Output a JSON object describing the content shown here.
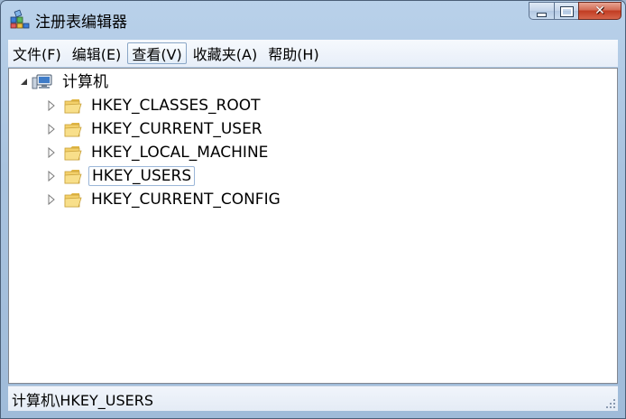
{
  "window": {
    "title": "注册表编辑器",
    "icon": "regedit-icon"
  },
  "caption_buttons": {
    "minimize_icon": "minimize-icon",
    "maximize_icon": "maximize-icon",
    "close_icon": "close-icon",
    "close_glyph": "✕"
  },
  "menubar": {
    "items": [
      {
        "label": "文件(F)"
      },
      {
        "label": "编辑(E)"
      },
      {
        "label": "查看(V)"
      },
      {
        "label": "收藏夹(A)"
      },
      {
        "label": "帮助(H)"
      }
    ],
    "active_index": 2
  },
  "tree": {
    "root": {
      "label": "计算机",
      "icon": "computer-icon",
      "expanded": true
    },
    "children": [
      {
        "label": "HKEY_CLASSES_ROOT",
        "icon": "folder-icon",
        "selected": false
      },
      {
        "label": "HKEY_CURRENT_USER",
        "icon": "folder-icon",
        "selected": false
      },
      {
        "label": "HKEY_LOCAL_MACHINE",
        "icon": "folder-icon",
        "selected": false
      },
      {
        "label": "HKEY_USERS",
        "icon": "folder-icon",
        "selected": true
      },
      {
        "label": "HKEY_CURRENT_CONFIG",
        "icon": "folder-icon",
        "selected": false
      }
    ]
  },
  "statusbar": {
    "path": "计算机\\HKEY_USERS"
  }
}
